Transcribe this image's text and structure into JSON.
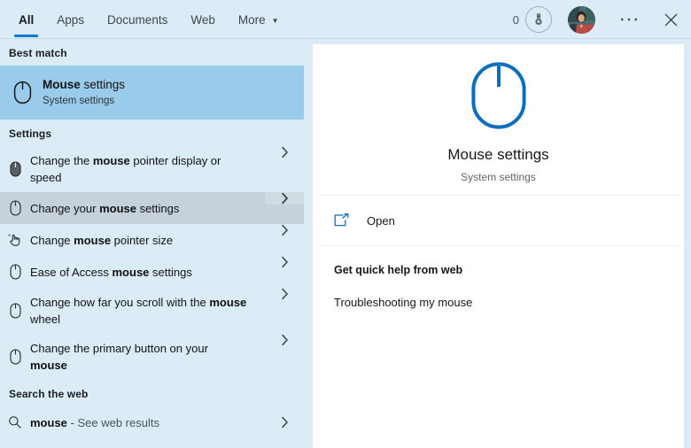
{
  "topbar": {
    "tabs": [
      {
        "label": "All",
        "active": true
      },
      {
        "label": "Apps",
        "active": false
      },
      {
        "label": "Documents",
        "active": false
      },
      {
        "label": "Web",
        "active": false
      },
      {
        "label": "More",
        "active": false,
        "has_caret": true
      }
    ],
    "reward_count": "0",
    "reward_icon": "medal-icon",
    "avatar_icon": "user-avatar",
    "more_icon": "ellipsis-icon",
    "close_icon": "close-icon",
    "accent_color": "#0078d4"
  },
  "left": {
    "best_match_header": "Best match",
    "best_match": {
      "title_bold": "Mouse",
      "title_rest": " settings",
      "subtitle": "System settings",
      "icon": "mouse-icon",
      "highlight_color": "#9bcbeb"
    },
    "settings_header": "Settings",
    "settings_items": [
      {
        "pre": "Change the ",
        "bold": "mouse",
        "post": " pointer display or speed",
        "icon": "mouse-icon",
        "hovered": false
      },
      {
        "pre": "Change your ",
        "bold": "mouse",
        "post": " settings",
        "icon": "mouse-icon",
        "hovered": true
      },
      {
        "pre": "Change ",
        "bold": "mouse",
        "post": " pointer size",
        "icon": "hand-pointer-icon",
        "hovered": false
      },
      {
        "pre": "Ease of Access ",
        "bold": "mouse",
        "post": " settings",
        "icon": "mouse-icon",
        "hovered": false
      },
      {
        "pre": "Change how far you scroll with the ",
        "bold": "mouse",
        "post": " wheel",
        "icon": "mouse-icon",
        "hovered": false
      },
      {
        "pre": "Change the primary button on your ",
        "bold": "mouse",
        "post": "",
        "icon": "mouse-icon",
        "hovered": false
      }
    ],
    "web_header": "Search the web",
    "web_item": {
      "bold": "mouse",
      "sub": " - See web results",
      "icon": "search-icon"
    },
    "background_color": "#dcecf7"
  },
  "right": {
    "hero_icon": "mouse-icon-large",
    "hero_icon_color": "#0c6ebd",
    "title": "Mouse settings",
    "subtitle": "System settings",
    "open_label": "Open",
    "open_icon": "open-external-icon",
    "help_title": "Get quick help from web",
    "help_link": "Troubleshooting my mouse"
  }
}
